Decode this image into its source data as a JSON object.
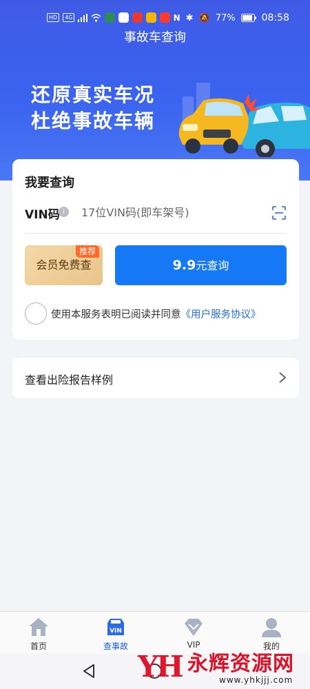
{
  "status_bar": {
    "left_chips": [
      "HD",
      "4G"
    ],
    "battery": "77%",
    "time": "08:58"
  },
  "header": {
    "title": "事故车查询",
    "hero_line1": "还原真实车况",
    "hero_line2": "杜绝事故车辆"
  },
  "query_card": {
    "title": "我要查询",
    "vin_label": "VIN码",
    "vin_placeholder": "17位VIN码(即车架号)",
    "member_button": "会员免费查",
    "member_badge": "推荐",
    "pay_price": "9.9",
    "pay_suffix": "元查询",
    "agree_text": "使用本服务表明已阅读并同意",
    "agree_link": "《用户服务协议》"
  },
  "sample_card": {
    "label": "查看出险报告样例"
  },
  "tabs": [
    {
      "label": "首页",
      "icon": "home-icon"
    },
    {
      "label": "查事故",
      "icon": "vin-car-icon",
      "active": true
    },
    {
      "label": "VIP",
      "icon": "vip-diamond-icon"
    },
    {
      "label": "我的",
      "icon": "profile-icon"
    }
  ],
  "watermark": {
    "logo": "YH",
    "text": "永辉资源网",
    "url": "www.yhkjjj.com"
  },
  "colors": {
    "brand_blue": "#1579f5",
    "hero_blue": "#3a63ef",
    "badge_orange": "#ff6a2b",
    "link_blue": "#1f6fd8"
  }
}
